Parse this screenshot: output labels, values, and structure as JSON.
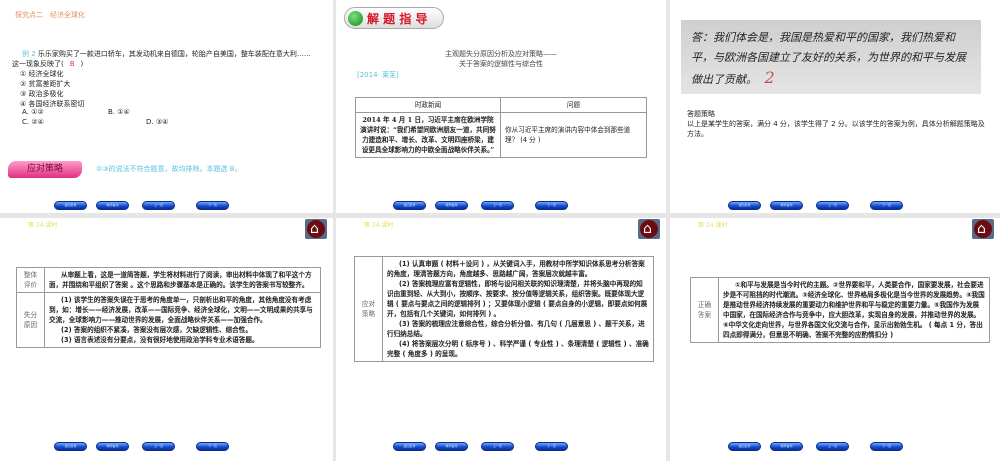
{
  "nav_buttons": [
    "返回目录",
    "教师备用",
    "上一页",
    "下一页"
  ],
  "lesson_label": "第 24 课时",
  "slide1": {
    "header": "探究点二　经济全球化",
    "example_label": "例 2",
    "question": "乐乐家购买了一款进口轿车，其发动机来自德国，轮胎产自美国，整车装配在意大利……这一现象反映了(",
    "question_end": ")",
    "answer": "B",
    "options": [
      "① 经济全球化",
      "② 贫富差距扩大",
      "③ 政治多极化",
      "④ 各国经济联系密切"
    ],
    "choices": [
      "A. ①②",
      "B. ①④",
      "C. ②④",
      "D. ③④"
    ],
    "strategy_badge": "应对策略",
    "strategy_text": "②③的说法不符合题意，故均排除。本题选 B。"
  },
  "slide2": {
    "badge": "解 题 指 导",
    "title_line1": "主观题失分原因分析及应对策略——",
    "title_line2": "关于答案的逻辑性与综合性",
    "source": "[2014· 莱芜]",
    "table_headers": [
      "时政新闻",
      "问题"
    ],
    "news": "2014 年 4 月 1 日，习近平主席在欧洲学院演讲时说：“我们希望同欧洲朋友一道，共同努力建造和平、增长、改革、文明四座桥梁，建设更具全球影响力的中欧全面战略伙伴关系。”",
    "question": "你从习近平主席的演讲内容中体会到那些道理？ (4 分 )"
  },
  "slide3": {
    "handwriting": "答：我们体会是，我国是热爱和平的国家，我们热爱和平，与欧洲各国建立了友好的关系，为世界的和平与发展做出了贡献。",
    "score_mark": "2",
    "strategy_title": "答题策略",
    "strategy_text": "以上是某学生的答案，满分 4 分，该学生得了 2 分。以该学生的答案为例，具体分析解题策略及方法。"
  },
  "slide4": {
    "rows": [
      {
        "label": "整体评价",
        "text": "从审题上看，这是一道简答题，学生将材料进行了阅读，审出材料中体现了和平这个方面，并围绕和平组织了答案 。这个思路和步骤基本是正确的。该学生的答案书写较整齐。"
      },
      {
        "label": "失分原因",
        "items": [
          "(1) 该学生的答案失误在于思考的角度单一，只剖析出和平的角度，其他角度没有考虑到，如：增长——经济发展，改革——国际竞争、经济全球化，文明——文明成果的共享与交流，全球影响力——推动世界的发展，全面战略伙伴关系——加强合作。",
          "(2) 答案的组织不紧凑，答案没有层次感，欠缺逻辑性、综合性。",
          "(3) 语言表述没有分要点，没有很好地使用政治学科专业术语答题。"
        ]
      }
    ]
  },
  "slide5": {
    "label": "应对策略",
    "items": [
      "(1) 认真审题 ( 材料＋设问 ) ，从关键词入手，用教材中所学知识体系思考分析答案的角度，理清答题方向，角度越多、思路越广阔，答案层次就越丰富。",
      "(2) 答案梳理应富有逻辑性，即将与设问相关联的知识理清楚，并将头脑中再现的知识由重到轻、从大到小，按顺序、按要求、按分值等逻辑关系，组织答案。既要体现大逻辑 ( 要点与要点之间的逻辑排列 ) ；又要体现小逻辑 ( 要点自身的小逻辑，即要点如何展开，包括有几个关键词，如何排列 ) 。",
      "(3) 答案的梳理应注意综合性，综合分析分值、有几句 ( 几层意思 ) 、题干关系，进行归纳总结。",
      "(4) 将答案层次分明 ( 标序号 ) 、科学严谨 ( 专业性 ) 、条理清楚 ( 逻辑性 ) 、准确完整 ( 角度多 ) 的呈现。"
    ]
  },
  "slide6": {
    "label": "正确答案",
    "text": "①和平与发展是当今时代的主题。②世界要和平，人类要合作，国家要发展，社会要进步是不可阻挡的时代潮流。③经济全球化、世界格局多极化是当今世界的发展趋势。④我国是推动世界经济持续发展的重要动力和维护世界和平与稳定的重要力量。⑤我国作为发展中国家，在国际经济合作与竞争中，应大胆改革，实现自身的发展，并推动世界的发展。⑥中华文化走向世界，与世界各国文化交流与合作，显示出勃勃生机。 ( 每点 1 分，答出四点即得满分，但意思不明确、答案不完整的应酌情扣分 )"
  }
}
